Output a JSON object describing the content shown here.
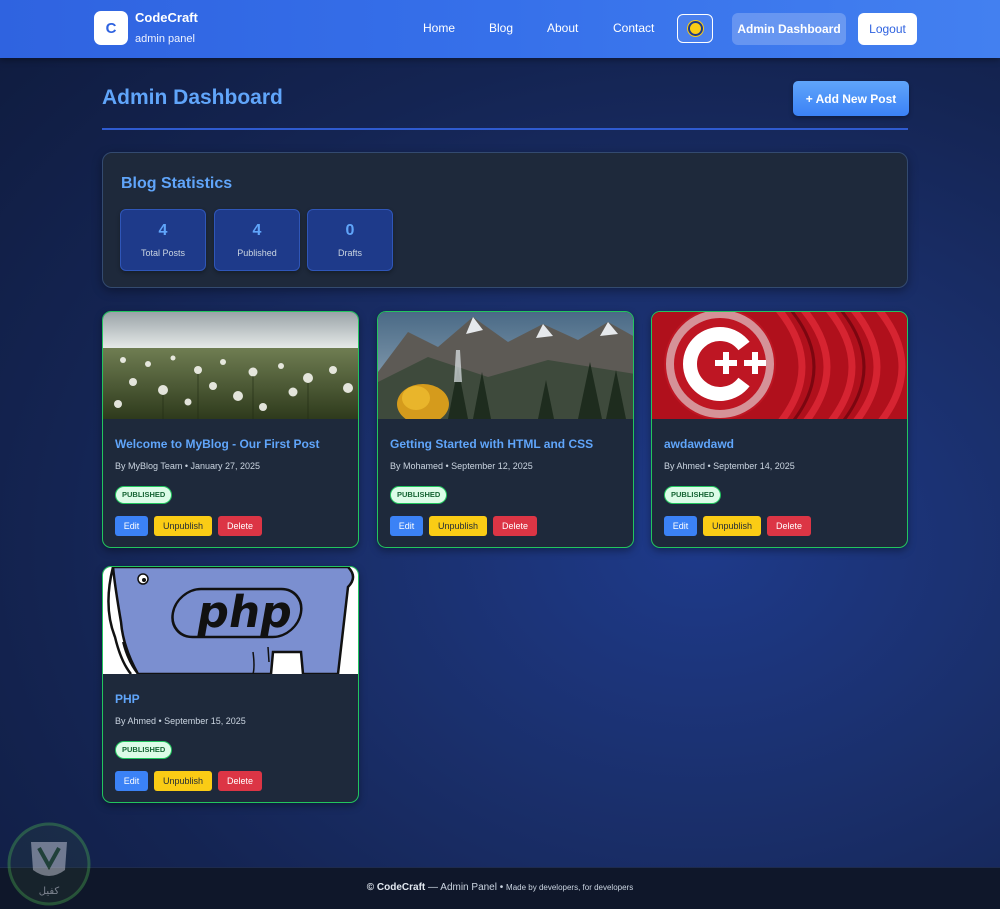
{
  "header": {
    "brand_initial": "C",
    "brand_name": "CodeCraft",
    "brand_subtitle": "admin panel",
    "nav": [
      "Home",
      "Blog",
      "About",
      "Contact"
    ],
    "theme_icon": "sun-icon",
    "admin_label": "Admin Dashboard",
    "logout_label": "Logout"
  },
  "page": {
    "title": "Admin Dashboard",
    "add_post_label": "+ Add New Post"
  },
  "stats": {
    "title": "Blog Statistics",
    "items": [
      {
        "value": "4",
        "label": "Total Posts"
      },
      {
        "value": "4",
        "label": "Published"
      },
      {
        "value": "0",
        "label": "Drafts"
      }
    ]
  },
  "posts": [
    {
      "title": "Welcome to MyBlog - Our First Post",
      "meta": "By MyBlog Team • January 27, 2025",
      "status": "PUBLISHED",
      "image": "dandelion-field"
    },
    {
      "title": "Getting Started with HTML and CSS",
      "meta": "By Mohamed • September 12, 2025",
      "status": "PUBLISHED",
      "image": "mountain-landscape"
    },
    {
      "title": "awdawdawd",
      "meta": "By Ahmed • September 14, 2025",
      "status": "PUBLISHED",
      "image": "cpp-logo"
    },
    {
      "title": "PHP",
      "meta": "By Ahmed • September 15, 2025",
      "status": "PUBLISHED",
      "image": "php-elephant"
    }
  ],
  "actions": {
    "edit": "Edit",
    "unpublish": "Unpublish",
    "delete": "Delete"
  },
  "footer": {
    "copyright": "© CodeCraft",
    "panel": " — Admin Panel • ",
    "tagline": "Made by developers, for developers"
  },
  "watermark_text": "كفيل"
}
